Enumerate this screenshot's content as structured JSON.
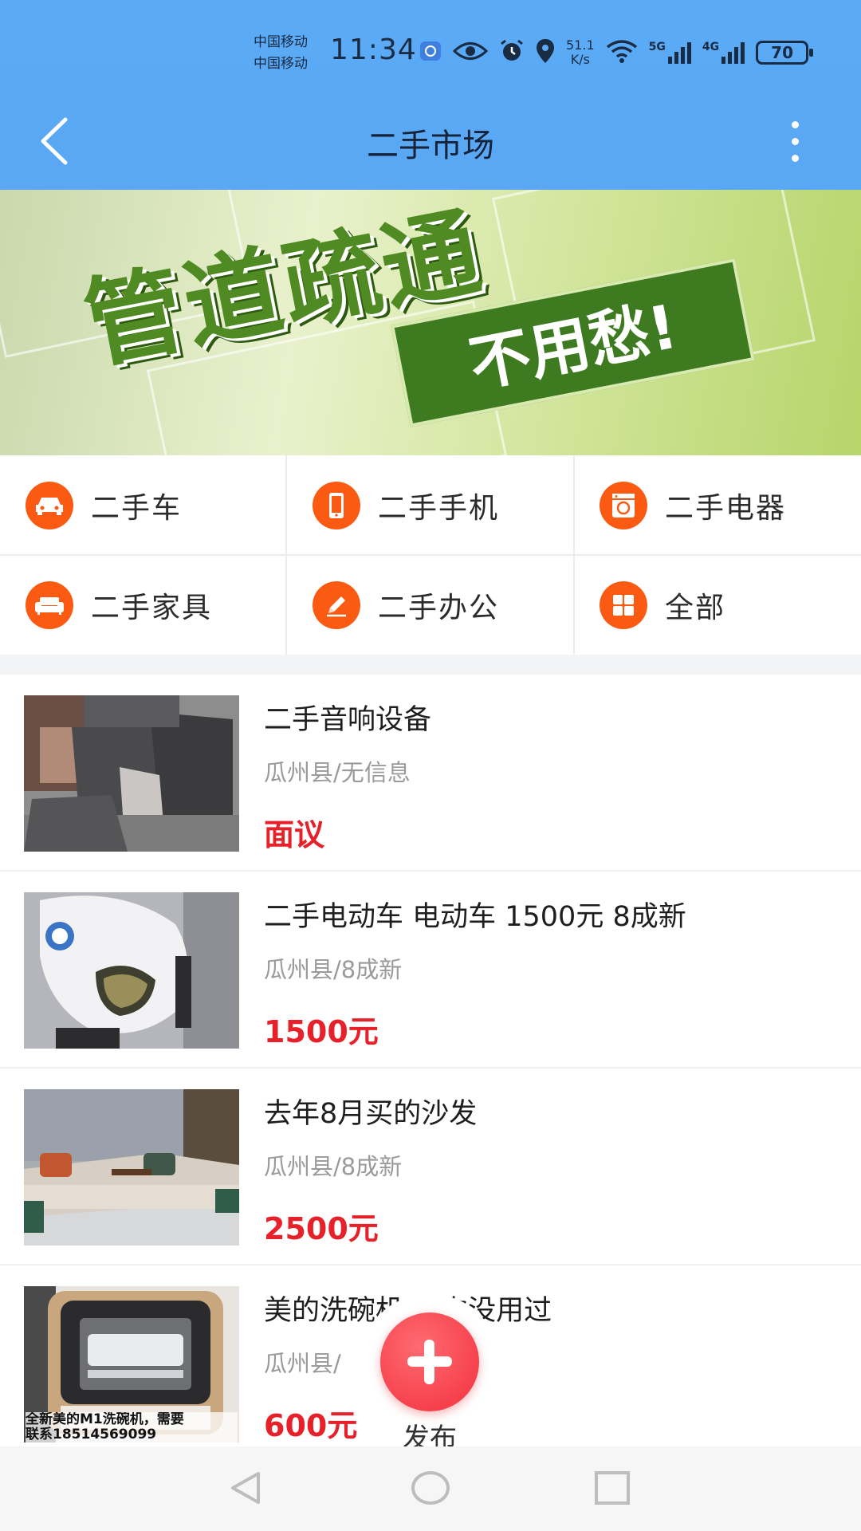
{
  "status_bar": {
    "carrier_1": "中国移动",
    "carrier_2": "中国移动",
    "time": "11:34",
    "net_speed_value": "51.1",
    "net_speed_unit": "K/s",
    "signal_1": "5G",
    "signal_2": "4G",
    "battery": "70"
  },
  "nav": {
    "title": "二手市场"
  },
  "banner": {
    "title": "管道疏通",
    "tagline": "不用愁!"
  },
  "categories": [
    {
      "label": "二手车",
      "icon": "car-icon"
    },
    {
      "label": "二手手机",
      "icon": "phone-icon"
    },
    {
      "label": "二手电器",
      "icon": "washing-machine-icon"
    },
    {
      "label": "二手家具",
      "icon": "sofa-icon"
    },
    {
      "label": "二手办公",
      "icon": "pencil-icon"
    },
    {
      "label": "全部",
      "icon": "grid-icon"
    }
  ],
  "listings": [
    {
      "title": "二手音响设备",
      "location": "瓜州县/无信息",
      "price": "面议"
    },
    {
      "title": "二手电动车 电动车 1500元 8成新",
      "location": "瓜州县/8成新",
      "price": "1500元"
    },
    {
      "title": "去年8月买的沙发",
      "location": "瓜州县/8成新",
      "price": "2500元"
    },
    {
      "title": "美的洗碗机   一次没用过",
      "location": "瓜州县/",
      "price": "600元",
      "image_caption_1": "全新美的M1洗碗机，需要",
      "image_caption_2": "联系18514569099"
    }
  ],
  "fab": {
    "label": "发布"
  },
  "colors": {
    "header_blue": "#5aaaf6",
    "accent_orange": "#fb5a12",
    "price_red": "#e6212a",
    "fab_red": "#f2313d"
  }
}
